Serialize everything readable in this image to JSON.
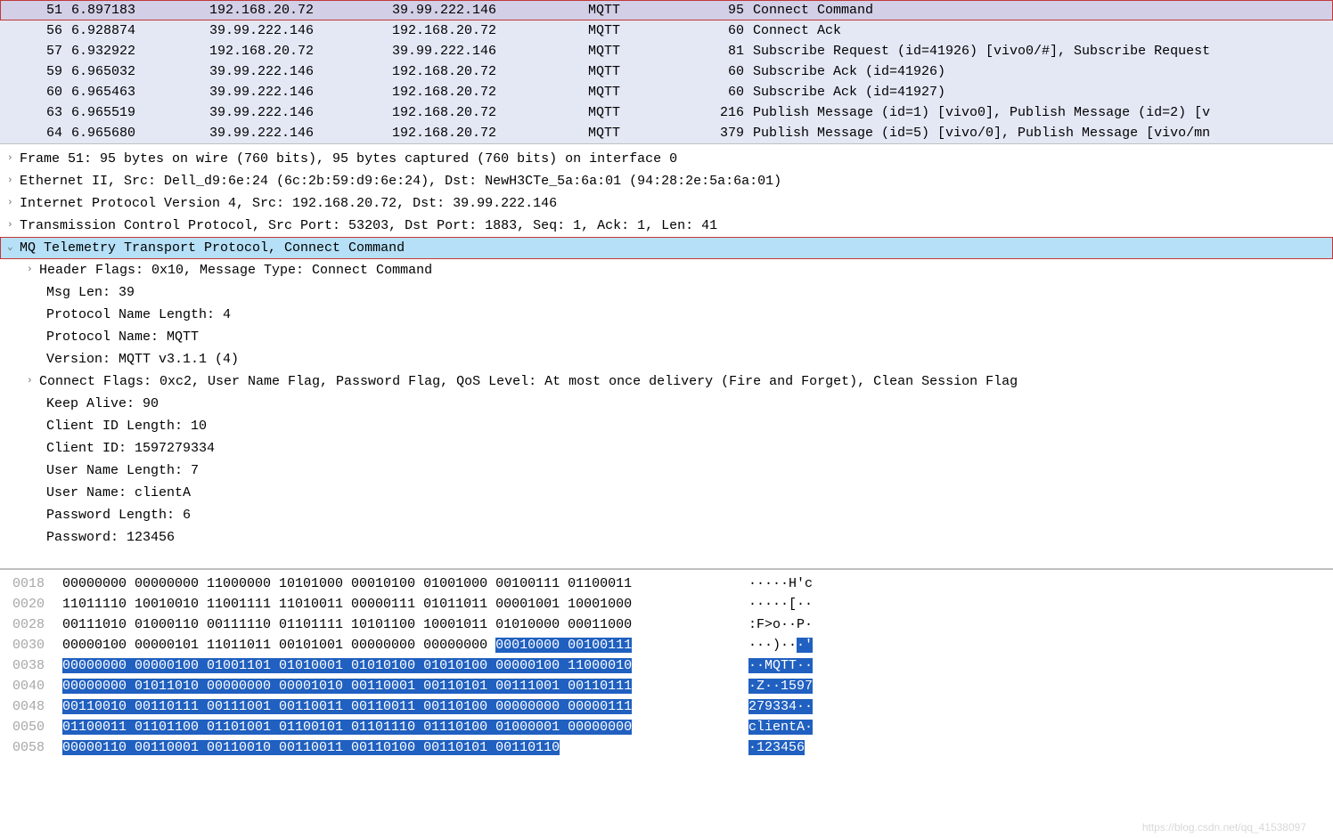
{
  "packets": [
    {
      "no": "51",
      "time": "6.897183",
      "src": "192.168.20.72",
      "dst": "39.99.222.146",
      "proto": "MQTT",
      "len": "95",
      "info": "Connect Command",
      "selected": true
    },
    {
      "no": "56",
      "time": "6.928874",
      "src": "39.99.222.146",
      "dst": "192.168.20.72",
      "proto": "MQTT",
      "len": "60",
      "info": "Connect Ack"
    },
    {
      "no": "57",
      "time": "6.932922",
      "src": "192.168.20.72",
      "dst": "39.99.222.146",
      "proto": "MQTT",
      "len": "81",
      "info": "Subscribe Request (id=41926) [vivo0/#], Subscribe Request"
    },
    {
      "no": "59",
      "time": "6.965032",
      "src": "39.99.222.146",
      "dst": "192.168.20.72",
      "proto": "MQTT",
      "len": "60",
      "info": "Subscribe Ack (id=41926)"
    },
    {
      "no": "60",
      "time": "6.965463",
      "src": "39.99.222.146",
      "dst": "192.168.20.72",
      "proto": "MQTT",
      "len": "60",
      "info": "Subscribe Ack (id=41927)"
    },
    {
      "no": "63",
      "time": "6.965519",
      "src": "39.99.222.146",
      "dst": "192.168.20.72",
      "proto": "MQTT",
      "len": "216",
      "info": "Publish Message (id=1) [vivo0], Publish Message (id=2) [v"
    },
    {
      "no": "64",
      "time": "6.965680",
      "src": "39.99.222.146",
      "dst": "192.168.20.72",
      "proto": "MQTT",
      "len": "379",
      "info": "Publish Message (id=5) [vivo/0], Publish Message [vivo/mn"
    }
  ],
  "details": {
    "frame": "Frame 51: 95 bytes on wire (760 bits), 95 bytes captured (760 bits) on interface 0",
    "eth": "Ethernet II, Src: Dell_d9:6e:24 (6c:2b:59:d9:6e:24), Dst: NewH3CTe_5a:6a:01 (94:28:2e:5a:6a:01)",
    "ip": "Internet Protocol Version 4, Src: 192.168.20.72, Dst: 39.99.222.146",
    "tcp": "Transmission Control Protocol, Src Port: 53203, Dst Port: 1883, Seq: 1, Ack: 1, Len: 41",
    "mqtt": "MQ Telemetry Transport Protocol, Connect Command",
    "hdr": "Header Flags: 0x10, Message Type: Connect Command",
    "msglen": "Msg Len: 39",
    "pnlen": "Protocol Name Length: 4",
    "pname": "Protocol Name: MQTT",
    "ver": "Version: MQTT v3.1.1 (4)",
    "cflags": "Connect Flags: 0xc2, User Name Flag, Password Flag, QoS Level: At most once delivery (Fire and Forget), Clean Session Flag",
    "keep": "Keep Alive: 90",
    "cidlen": "Client ID Length: 10",
    "cid": "Client ID: 1597279334",
    "unlen": "User Name Length: 7",
    "uname": "User Name: clientA",
    "pwlen": "Password Length: 6",
    "pw": "Password: 123456"
  },
  "hex": [
    {
      "off": "0018",
      "b": "00000000 00000000 11000000 10101000 00010100 01001000 00100111 01100011",
      "a": "·····H'c",
      "hs": 0,
      "as": 0
    },
    {
      "off": "0020",
      "b": "11011110 10010010 11001111 11010011 00000111 01011011 00001001 10001000",
      "a": "·····[··",
      "hs": 0,
      "as": 0
    },
    {
      "off": "0028",
      "b": "00111010 01000110 00111110 01101111 10101100 10001011 01010000 00011000",
      "a": ":F>o··P·",
      "hs": 0,
      "as": 0
    },
    {
      "off": "0030",
      "b": "00000100 00000101 11011011 00101001 00000000 00000000 ",
      "tail": "00010000 00100111",
      "a": "···)··",
      "atail": "·'",
      "hs": 54,
      "as": 6
    },
    {
      "off": "0038",
      "b": "",
      "tail": "00000000 00000100 01001101 01010001 01010100 01010100 00000100 11000010",
      "a": "",
      "atail": "··MQTT··",
      "hs": 0,
      "as": 0
    },
    {
      "off": "0040",
      "b": "",
      "tail": "00000000 01011010 00000000 00001010 00110001 00110101 00111001 00110111",
      "a": "",
      "atail": "·Z··1597",
      "hs": 0,
      "as": 0
    },
    {
      "off": "0048",
      "b": "",
      "tail": "00110010 00110111 00111001 00110011 00110011 00110100 00000000 00000111",
      "a": "",
      "atail": "279334··",
      "hs": 0,
      "as": 0
    },
    {
      "off": "0050",
      "b": "",
      "tail": "01100011 01101100 01101001 01100101 01101110 01110100 01000001 00000000",
      "a": "",
      "atail": "clientA·",
      "hs": 0,
      "as": 0
    },
    {
      "off": "0058",
      "b": "",
      "tail": "00000110 00110001 00110010 00110011 00110100 00110101 00110110",
      "a": "",
      "atail": "·123456",
      "hs": 0,
      "as": 0
    }
  ],
  "watermark": "https://blog.csdn.net/qq_41538097"
}
